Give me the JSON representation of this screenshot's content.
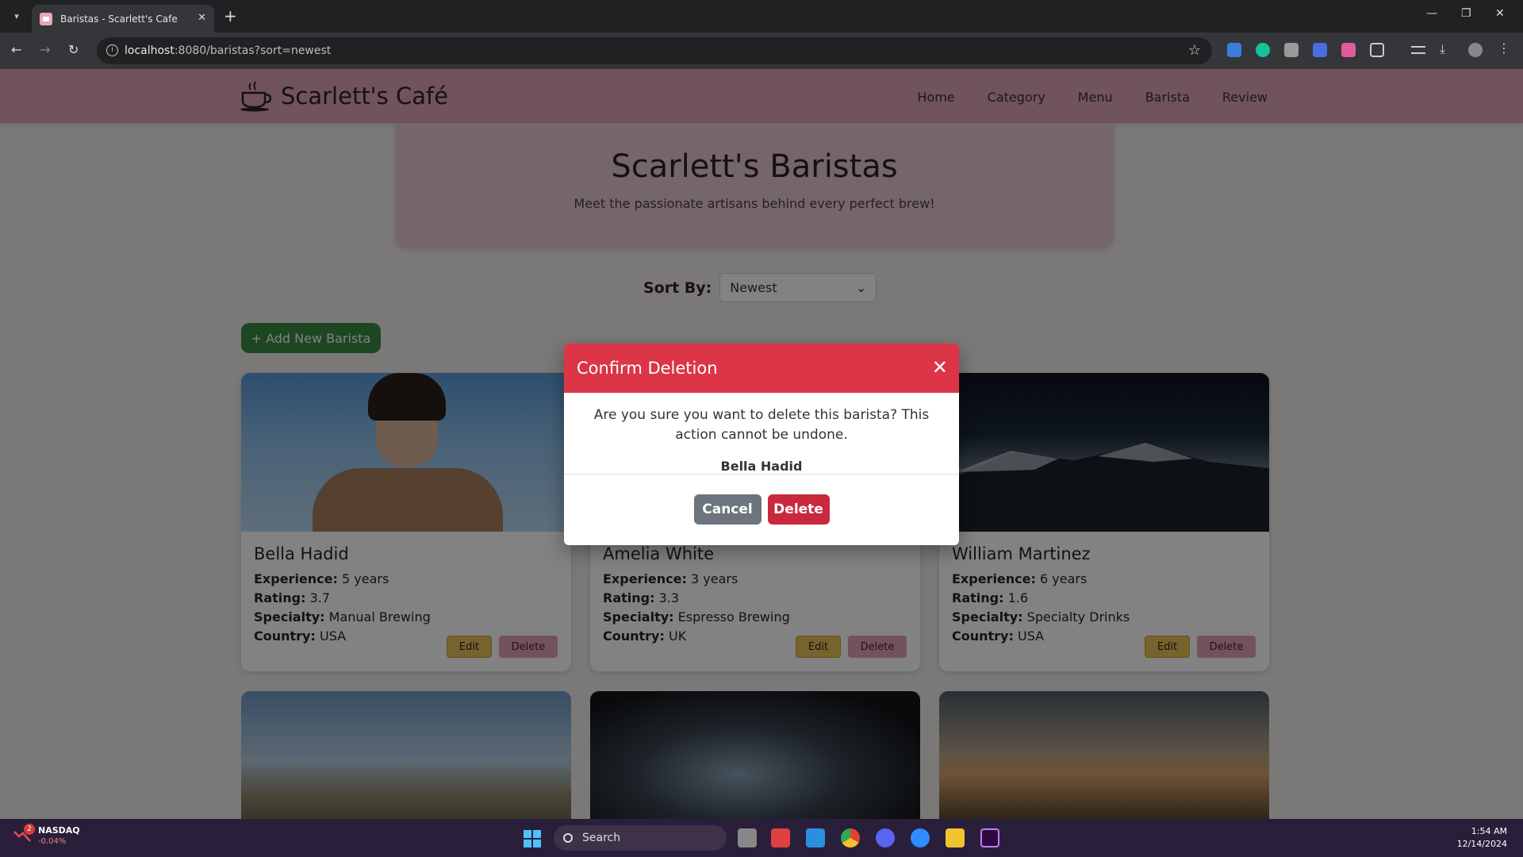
{
  "browser": {
    "tab_title": "Baristas - Scarlett's Cafe",
    "url_host": "localhost",
    "url_rest": ":8080/baristas?sort=newest"
  },
  "site": {
    "brand": "Scarlett's Café",
    "nav": [
      "Home",
      "Category",
      "Menu",
      "Barista",
      "Review"
    ]
  },
  "hero": {
    "title": "Scarlett's Baristas",
    "subtitle": "Meet the passionate artisans behind every perfect brew!"
  },
  "sort": {
    "label": "Sort By:",
    "selected": "Newest"
  },
  "add_button": "+ Add New Barista",
  "labels": {
    "experience": "Experience:",
    "rating": "Rating:",
    "specialty": "Specialty:",
    "country": "Country:",
    "edit": "Edit",
    "delete": "Delete"
  },
  "baristas": [
    {
      "name": "Bella Hadid",
      "experience": "5 years",
      "rating": "3.7",
      "specialty": "Manual Brewing",
      "country": "USA"
    },
    {
      "name": "Amelia White",
      "experience": "3 years",
      "rating": "3.3",
      "specialty": "Espresso Brewing",
      "country": "UK"
    },
    {
      "name": "William Martinez",
      "experience": "6 years",
      "rating": "1.6",
      "specialty": "Specialty Drinks",
      "country": "USA"
    }
  ],
  "modal": {
    "title": "Confirm Deletion",
    "message": "Are you sure you want to delete this barista? This action cannot be undone.",
    "barista_name": "Bella Hadid",
    "cancel": "Cancel",
    "confirm": "Delete"
  },
  "taskbar": {
    "ticker_name": "NASDAQ",
    "ticker_change": "-0.04%",
    "ticker_badge": "2",
    "search_placeholder": "Search",
    "time": "1:54 AM",
    "date": "12/14/2024"
  },
  "colors": {
    "header": "#dba4b4",
    "modal_header": "#dc3545",
    "add_button": "#3a8c46",
    "edit_button": "#e7c35a",
    "delete_button": "#e3a2b2"
  }
}
